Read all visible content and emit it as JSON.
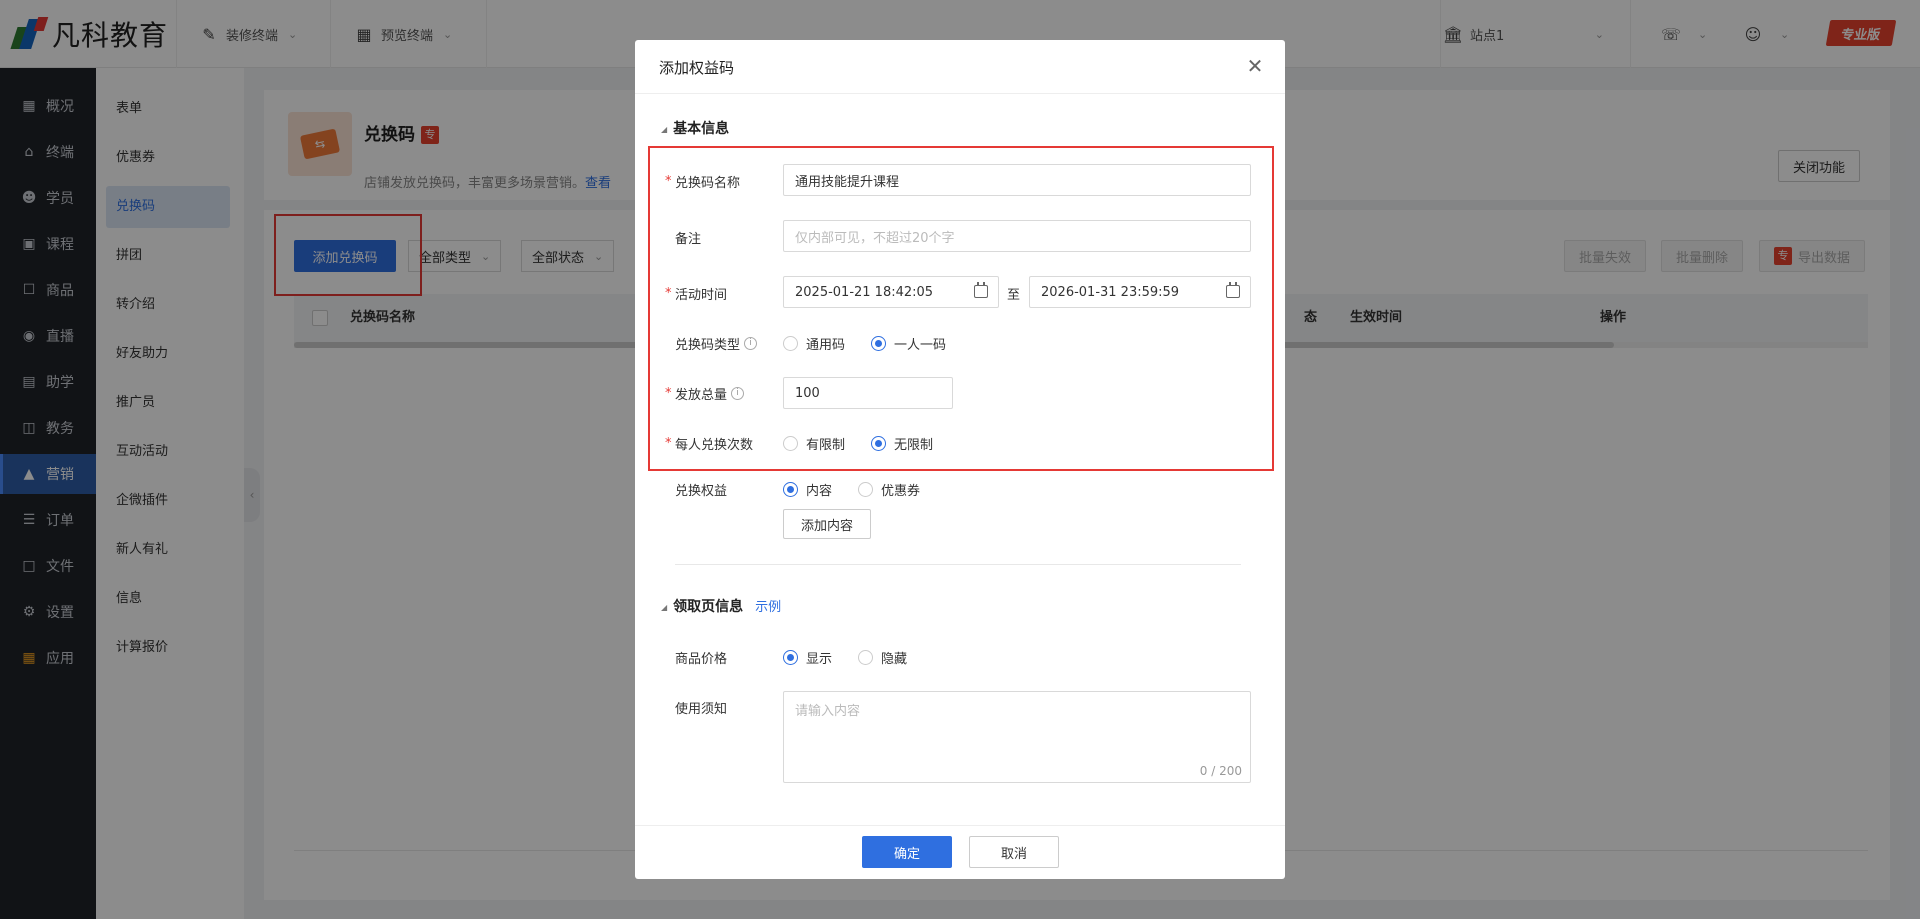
{
  "header": {
    "logo_text": "凡科教育",
    "decorate_label": "装修终端",
    "preview_label": "预览终端",
    "site_label": "站点1",
    "edition_badge": "专业版"
  },
  "leftnav": {
    "items": [
      {
        "label": "概况",
        "icon": "grid-icon"
      },
      {
        "label": "终端",
        "icon": "store-icon"
      },
      {
        "label": "学员",
        "icon": "users-icon"
      },
      {
        "label": "课程",
        "icon": "course-icon"
      },
      {
        "label": "商品",
        "icon": "goods-icon"
      },
      {
        "label": "直播",
        "icon": "live-icon"
      },
      {
        "label": "助学",
        "icon": "study-icon"
      },
      {
        "label": "教务",
        "icon": "book-icon"
      },
      {
        "label": "营销",
        "icon": "marketing-icon"
      },
      {
        "label": "订单",
        "icon": "order-icon"
      },
      {
        "label": "文件",
        "icon": "folder-icon"
      },
      {
        "label": "设置",
        "icon": "gear-icon"
      },
      {
        "label": "应用",
        "icon": "apps-icon"
      }
    ],
    "active": "营销"
  },
  "subnav": {
    "items": [
      "表单",
      "优惠券",
      "兑换码",
      "拼团",
      "转介绍",
      "好友助力",
      "推广员",
      "互动活动",
      "企微插件",
      "新人有礼",
      "信息",
      "计算报价"
    ],
    "active": "兑换码"
  },
  "feature": {
    "title": "兑换码",
    "badge": "专",
    "desc": "店铺发放兑换码，丰富更多场景营销。",
    "desc_link": "查看",
    "close_label": "关闭功能"
  },
  "toolbar": {
    "add_label": "添加兑换码",
    "type_filter": "全部类型",
    "status_filter": "全部状态",
    "batch_invalid": "批量失效",
    "batch_delete": "批量删除",
    "export": "导出数据",
    "export_badge": "专"
  },
  "table": {
    "col_name": "兑换码名称",
    "col_status_tail": "态",
    "col_effective": "生效时间",
    "col_actions": "操作"
  },
  "modal": {
    "title": "添加权益码",
    "section_basic": "基本信息",
    "name_label": "兑换码名称",
    "name_value": "通用技能提升课程",
    "remark_label": "备注",
    "remark_placeholder": "仅内部可见，不超过20个字",
    "time_label": "活动时间",
    "time_start": "2025-01-21 18:42:05",
    "time_sep": "至",
    "time_end": "2026-01-31 23:59:59",
    "type_label": "兑换码类型",
    "type_options": [
      "通用码",
      "一人一码"
    ],
    "type_selected": "一人一码",
    "total_label": "发放总量",
    "total_value": "100",
    "per_user_label": "每人兑换次数",
    "per_user_options": [
      "有限制",
      "无限制"
    ],
    "per_user_selected": "无限制",
    "benefit_label": "兑换权益",
    "benefit_options": [
      "内容",
      "优惠券"
    ],
    "benefit_selected": "内容",
    "add_content_label": "添加内容",
    "section_page": "领取页信息",
    "example_link": "示例",
    "price_label": "商品价格",
    "price_options": [
      "显示",
      "隐藏"
    ],
    "price_selected": "显示",
    "notice_label": "使用须知",
    "notice_placeholder": "请输入内容",
    "notice_count": "0 / 200",
    "ok_label": "确定",
    "cancel_label": "取消"
  },
  "colors": {
    "accent": "#2f6fe0",
    "highlight_box": "#e53935",
    "nav_bg": "#1f2329",
    "edition_badge": "#e8432f"
  }
}
